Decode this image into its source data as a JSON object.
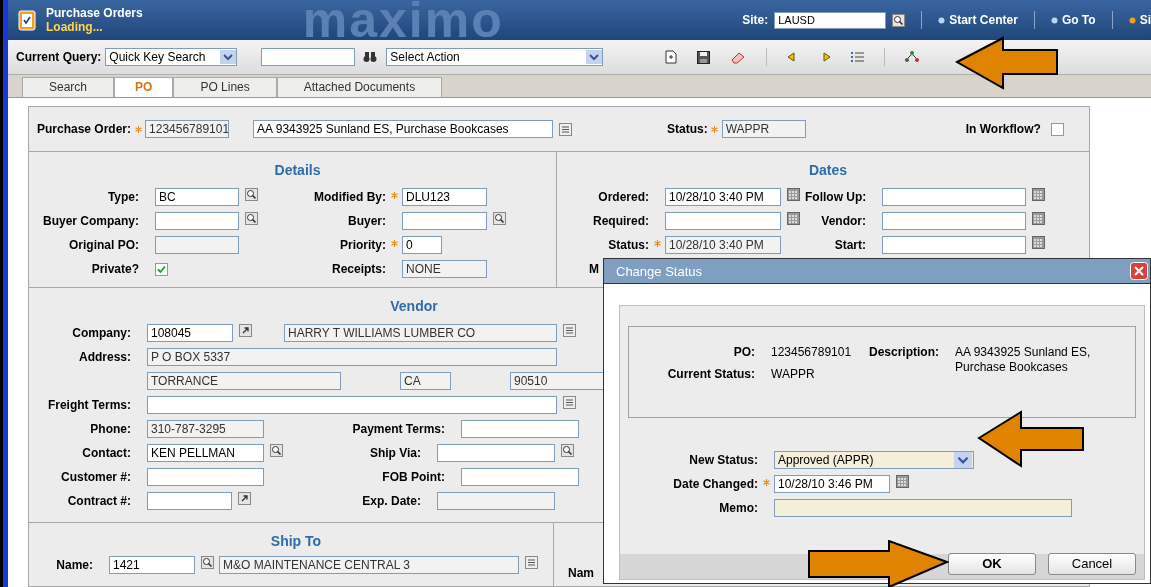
{
  "header": {
    "title": "Purchase Orders",
    "status": "Loading...",
    "logo": "maximo",
    "site_label": "Site:",
    "site_value": "LAUSD",
    "links": [
      "Start Center",
      "Go To",
      "Si"
    ]
  },
  "toolbar": {
    "query_label": "Current Query:",
    "query_value": "Quick Key Search",
    "action_value": "Select Action"
  },
  "tabs": [
    {
      "label": "Search",
      "selected": false
    },
    {
      "label": "PO",
      "selected": true
    },
    {
      "label": "PO Lines",
      "selected": false
    },
    {
      "label": "Attached Documents",
      "selected": false
    }
  ],
  "record": {
    "po_label": "Purchase Order:",
    "po_number": "123456789101",
    "description": "AA 9343925 Sunland ES, Purchase Bookcases",
    "status_label": "Status:",
    "status": "WAPPR",
    "workflow_label": "In Workflow?",
    "in_workflow": false
  },
  "details": {
    "title": "Details",
    "rows": [
      [
        {
          "label": "Type:",
          "value": "BC",
          "kind": "text",
          "required": false
        },
        {
          "label": "Modified By:",
          "value": "DLU123",
          "kind": "text",
          "required": true
        }
      ],
      [
        {
          "label": "Buyer Company:",
          "kind": "text",
          "required": false
        },
        {
          "label": "Buyer:",
          "kind": "text",
          "required": false
        }
      ],
      [
        {
          "label": "Original PO:",
          "kind": "readonly",
          "required": false
        },
        {
          "label": "Priority:",
          "value": "0",
          "kind": "text",
          "required": true
        }
      ],
      [
        {
          "label": "Private?",
          "kind": "checkbox",
          "checked": true,
          "required": false
        },
        {
          "label": "Receipts:",
          "value": "NONE",
          "kind": "readonly",
          "required": false
        }
      ]
    ]
  },
  "dates": {
    "title": "Dates",
    "rows": [
      [
        {
          "label": "Ordered:",
          "value": "10/28/10 3:40 PM",
          "kind": "text",
          "required": false
        },
        {
          "label": "Follow Up:",
          "kind": "text",
          "required": false
        }
      ],
      [
        {
          "label": "Required:",
          "kind": "text",
          "required": false
        },
        {
          "label": "Vendor:",
          "kind": "text",
          "required": false
        }
      ],
      [
        {
          "label": "Status:",
          "value": "10/28/10 3:40 PM",
          "kind": "readonly",
          "required": true
        },
        {
          "label": "Start:",
          "kind": "text",
          "required": false
        }
      ],
      [
        {
          "label": "M",
          "kind": "label",
          "required": false
        }
      ]
    ]
  },
  "vendor": {
    "title": "Vendor",
    "rows": [
      [
        {
          "label": "Company:",
          "value": "108045",
          "kind": "text",
          "required": false
        },
        {
          "value": "HARRY T WILLIAMS LUMBER CO",
          "kind": "readonly",
          "required": false
        }
      ],
      [
        {
          "label": "Address:",
          "value": "P O BOX 5337",
          "kind": "readonly",
          "required": false
        }
      ],
      [
        {
          "value": "TORRANCE",
          "kind": "readonly",
          "required": false
        },
        {
          "value": "CA",
          "kind": "readonly",
          "required": false
        },
        {
          "value": "90510",
          "kind": "readonly",
          "required": false
        }
      ],
      [
        {
          "label": "Freight Terms:",
          "kind": "text",
          "required": false
        }
      ],
      [
        {
          "label": "Phone:",
          "value": "310-787-3295",
          "kind": "readonly",
          "required": false
        },
        {
          "label": "Payment Terms:",
          "kind": "text",
          "required": false
        }
      ],
      [
        {
          "label": "Contact:",
          "value": "KEN PELLMAN",
          "kind": "text",
          "required": false
        },
        {
          "label": "Ship Via:",
          "kind": "text",
          "required": false
        }
      ],
      [
        {
          "label": "Customer #:",
          "kind": "text",
          "required": false
        },
        {
          "label": "FOB Point:",
          "kind": "text",
          "required": false
        }
      ],
      [
        {
          "label": "Contract #:",
          "kind": "text",
          "required": false
        },
        {
          "label": "Exp. Date:",
          "kind": "readonly",
          "required": false
        }
      ]
    ]
  },
  "ship_to": {
    "title": "Ship To",
    "rows": [
      [
        {
          "label": "Name:",
          "value": "1421",
          "kind": "text",
          "required": false
        },
        {
          "value": "M&O MAINTENANCE CENTRAL 3",
          "kind": "readonly",
          "required": false
        }
      ]
    ],
    "right_label": "Nam"
  },
  "dialog": {
    "title": "Change Status",
    "po_label": "PO:",
    "po_value": "123456789101",
    "description_label": "Description:",
    "description_value": "AA 9343925 Sunland ES, Purchase Bookcases",
    "current_status_label": "Current Status:",
    "current_status": "WAPPR",
    "fields": [
      {
        "label": "New Status:",
        "value": "Approved (APPR)",
        "kind": "select",
        "required": false
      },
      {
        "label": "Date Changed:",
        "value": "10/28/10 3:46 PM",
        "kind": "text",
        "required": true
      },
      {
        "label": "Memo:",
        "kind": "memo",
        "required": false
      }
    ],
    "buttons": [
      "OK",
      "Cancel"
    ]
  }
}
